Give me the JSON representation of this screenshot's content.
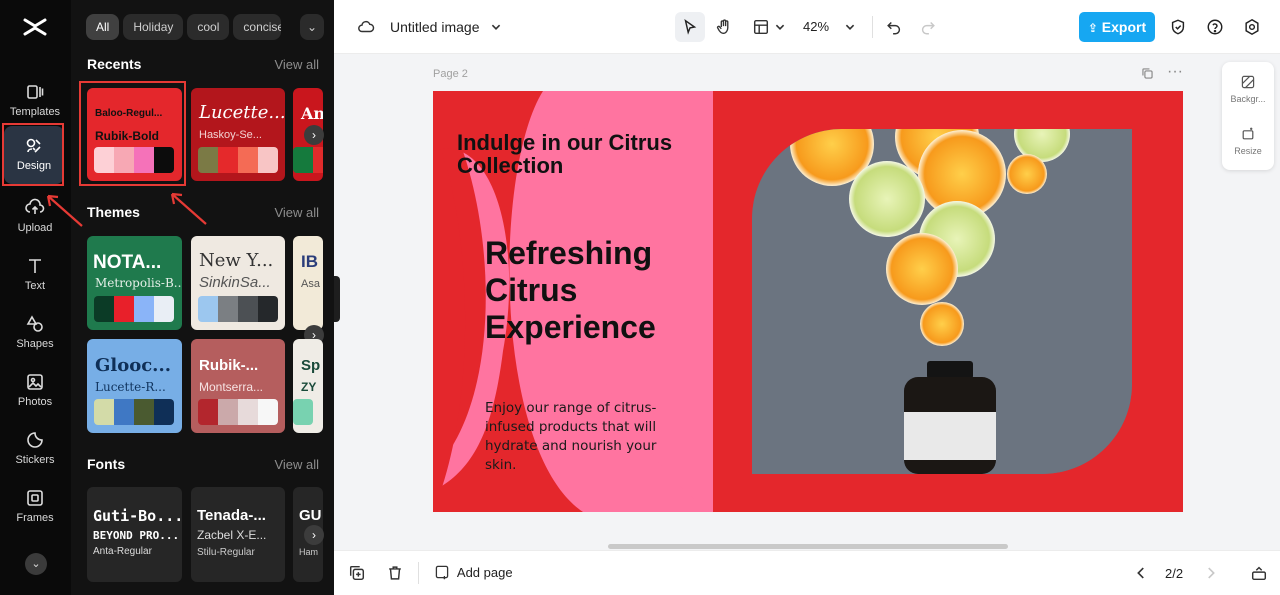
{
  "rail": {
    "items": [
      {
        "label": "Templates",
        "icon": "templates-icon"
      },
      {
        "label": "Design",
        "icon": "design-icon",
        "active": true
      },
      {
        "label": "Upload",
        "icon": "upload-icon"
      },
      {
        "label": "Text",
        "icon": "text-icon"
      },
      {
        "label": "Shapes",
        "icon": "shapes-icon"
      },
      {
        "label": "Photos",
        "icon": "photos-icon"
      },
      {
        "label": "Stickers",
        "icon": "stickers-icon"
      },
      {
        "label": "Frames",
        "icon": "frames-icon"
      }
    ]
  },
  "panel": {
    "chips": [
      "All",
      "Holiday",
      "cool",
      "concise"
    ],
    "recents": {
      "title": "Recents",
      "view_all": "View all",
      "cards": [
        {
          "t1": "Baloo-Regul...",
          "t2": "Rubik-Bold",
          "bg": "#e4272c",
          "swatches": [
            "#fdd0d6",
            "#f7a8b4",
            "#f572b9",
            "#0c0c0c"
          ]
        },
        {
          "t1": "Lucette...",
          "t2": "Haskoy-Se...",
          "bg": "#b3161c",
          "swatches": [
            "#7b7a45",
            "#e5292b",
            "#f46b55",
            "#f8c5c5"
          ]
        },
        {
          "t1": "Ant",
          "t2": "",
          "bg": "#c9161d",
          "swatches": [
            "#157a3d",
            "#e12b2b"
          ]
        }
      ]
    },
    "themes": {
      "title": "Themes",
      "view_all": "View all",
      "cards": [
        {
          "t1": "NOTA...",
          "t2": "Metropolis-B...",
          "bg": "#1f7a4d",
          "swatches": [
            "#0b3b26",
            "#e8202a",
            "#8ab4f8",
            "#e9eef5"
          ]
        },
        {
          "t1": "New Y...",
          "t2": "SinkinSa...",
          "bg": "#efe9e1",
          "swatches": [
            "#9cc7ef",
            "#7b7f83",
            "#4c5054",
            "#25282b"
          ]
        },
        {
          "t1": "IB",
          "t2": "Asa",
          "bg": "#f2ead8",
          "swatches": [
            "#3a4f8a"
          ]
        },
        {
          "t1": "Glooc...",
          "t2": "Lucette-R...",
          "bg": "#77aee6",
          "swatches": [
            "#d3dba8",
            "#3f78c4",
            "#4a5a30",
            "#0f2f57"
          ]
        },
        {
          "t1": "Rubik-...",
          "t2": "Montserra...",
          "bg": "#b55e5e",
          "swatches": [
            "#b3262d",
            "#cba9aa",
            "#e7dada",
            "#f7f7f7"
          ]
        },
        {
          "t1": "Sp",
          "t2": "ZY",
          "bg": "#efece6",
          "swatches": [
            "#78d2b0"
          ]
        }
      ]
    },
    "fonts": {
      "title": "Fonts",
      "view_all": "View all",
      "cards": [
        {
          "t1": "Guti-Bo...",
          "t2": "BEYOND PRO...",
          "t3": "Anta-Regular"
        },
        {
          "t1": "Tenada-...",
          "t2": "Zacbel X-E...",
          "t3": "Stilu-Regular"
        },
        {
          "t1": "GU",
          "t2": "",
          "t3": "Ham"
        }
      ]
    }
  },
  "topbar": {
    "doc_title": "Untitled image",
    "zoom": "42%",
    "export_label": "Export"
  },
  "canvas": {
    "page_label": "Page 2",
    "headline": "Indulge in our Citrus Collection",
    "big_title": "Refreshing Citrus Experience",
    "body_copy": "Enjoy our range of citrus-infused products that will hydrate and nourish your skin."
  },
  "side_tools": [
    {
      "label": "Backgr...",
      "icon": "background-icon"
    },
    {
      "label": "Resize",
      "icon": "resize-icon"
    }
  ],
  "bottombar": {
    "add_page_label": "Add page",
    "pager": "2/2"
  },
  "colors": {
    "accent": "#16a7f2",
    "artboard_red": "#e4272c",
    "artboard_pink": "#ff74a0",
    "highlight": "#e63a35"
  }
}
